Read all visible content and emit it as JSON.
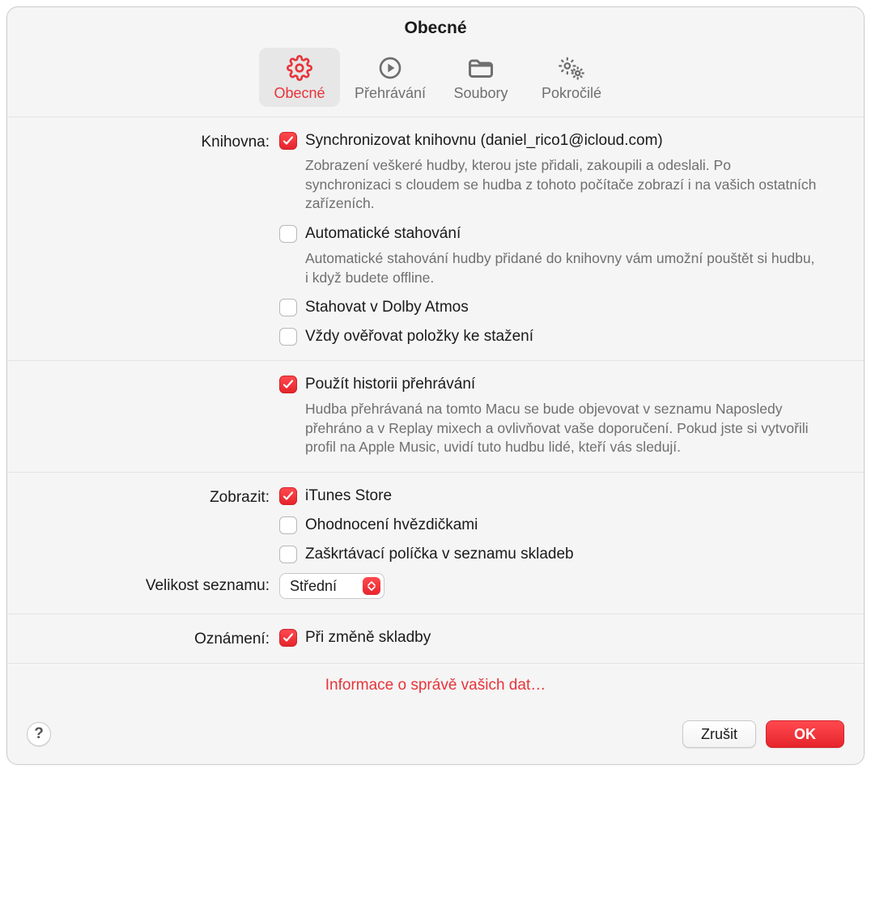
{
  "title": "Obecné",
  "tabs": [
    {
      "label": "Obecné",
      "active": true
    },
    {
      "label": "Přehrávání",
      "active": false
    },
    {
      "label": "Soubory",
      "active": false
    },
    {
      "label": "Pokročilé",
      "active": false
    }
  ],
  "library": {
    "heading": "Knihovna:",
    "sync": {
      "label": "Synchronizovat knihovnu (daniel_rico1@icloud.com)",
      "checked": true,
      "desc": "Zobrazení veškeré hudby, kterou jste přidali, zakoupili a odeslali. Po synchronizaci s cloudem se hudba z tohoto počítače zobrazí i na vašich ostatních zařízeních."
    },
    "autodl": {
      "label": "Automatické stahování",
      "checked": false,
      "desc": "Automatické stahování hudby přidané do knihovny vám umožní pouštět si hudbu, i když budete offline."
    },
    "dolby": {
      "label": "Stahovat v Dolby Atmos",
      "checked": false
    },
    "verify": {
      "label": "Vždy ověřovat položky ke stažení",
      "checked": false
    }
  },
  "history": {
    "label": "Použít historii přehrávání",
    "checked": true,
    "desc": "Hudba přehrávaná na tomto Macu se bude objevovat v seznamu Naposledy přehráno a v Replay mixech a ovlivňovat vaše doporučení. Pokud jste si vytvořili profil na Apple Music, uvidí tuto hudbu lidé, kteří vás sledují."
  },
  "show": {
    "heading": "Zobrazit:",
    "itunes": {
      "label": "iTunes Store",
      "checked": true
    },
    "stars": {
      "label": "Ohodnocení hvězdičkami",
      "checked": false
    },
    "checkboxes": {
      "label": "Zaškrtávací políčka v seznamu skladeb",
      "checked": false
    }
  },
  "listsize": {
    "heading": "Velikost seznamu:",
    "value": "Střední"
  },
  "notifications": {
    "heading": "Oznámení:",
    "onchange": {
      "label": "Při změně skladby",
      "checked": true
    }
  },
  "datalink": "Informace o správě vašich dat…",
  "footer": {
    "help": "?",
    "cancel": "Zrušit",
    "ok": "OK"
  }
}
